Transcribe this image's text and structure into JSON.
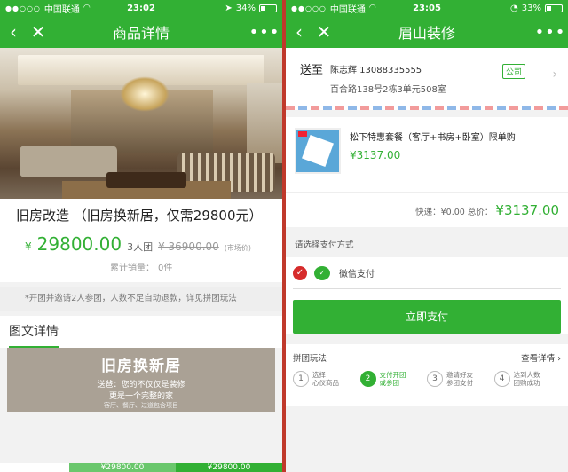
{
  "left": {
    "status": {
      "carrier": "中国联通",
      "time": "23:02",
      "battery": "34%",
      "battery_level": 0.34
    },
    "nav": {
      "title": "商品详情",
      "back": "‹",
      "close": "✕",
      "more": "•••"
    },
    "product": {
      "title": "旧房改造 （旧房换新居，仅需29800元）",
      "currency": "¥",
      "price": "29800.00",
      "team": "3人团",
      "original_price": "¥ 36900.00",
      "market_label": "(市场价)",
      "sold_label": "累计销量：",
      "sold_value": "0件"
    },
    "notice": "*开团并邀请2人参团，人数不足自动退款，详见拼团玩法",
    "section_title": "图文详情",
    "banner": {
      "title": "旧房换新居",
      "line1": "送爸：您的不仅仅是装修",
      "line2": "更是一个完整的家",
      "line3": "客厅、餐厅、过道包含项目"
    },
    "bottom": {
      "btn_a": "¥29800.00",
      "btn_b": "¥29800.00"
    }
  },
  "right": {
    "status": {
      "carrier": "中国联通",
      "time": "23:05",
      "battery": "33%",
      "battery_level": 0.33
    },
    "nav": {
      "title": "眉山装修",
      "back": "‹",
      "close": "✕",
      "more": "•••"
    },
    "address": {
      "to_label": "送至",
      "name_phone": "陈志辉  13088335555",
      "detail": "百合路138号2栋3单元508室",
      "tag": "公司"
    },
    "goods": {
      "name": "松下特惠套餐（客厅+书房+卧室）限单购",
      "price": "¥3137.00"
    },
    "totals": {
      "shipping": "快递：¥0.00",
      "total_label": "总价：",
      "total": "¥3137.00"
    },
    "pay_label": "请选择支付方式",
    "pay_method": "微信支付",
    "pay_button": "立即支付",
    "group": {
      "title": "拼团玩法",
      "link": "查看详情 ›",
      "steps": [
        {
          "num": "1",
          "l1": "选择",
          "l2": "心仪商品"
        },
        {
          "num": "2",
          "l1": "支付开团",
          "l2": "或参团"
        },
        {
          "num": "3",
          "l1": "邀请好友",
          "l2": "参团支付"
        },
        {
          "num": "4",
          "l1": "达到人数",
          "l2": "团购成功"
        }
      ]
    }
  },
  "colors": {
    "brand": "#32b034",
    "alert": "#d62b2b"
  }
}
